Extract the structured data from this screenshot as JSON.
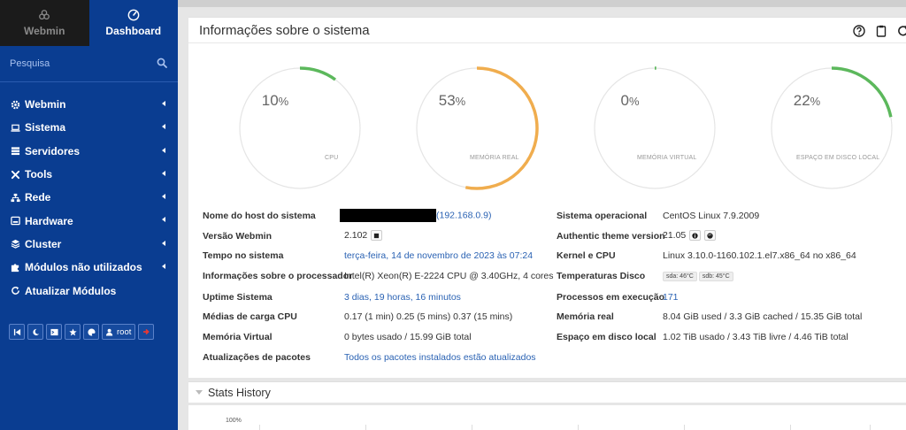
{
  "sidebar": {
    "tabs": [
      {
        "label": "Webmin",
        "icon": "webmin-logo-icon",
        "active": false
      },
      {
        "label": "Dashboard",
        "icon": "dashboard-icon",
        "active": true
      }
    ],
    "search_placeholder": "Pesquisa",
    "menu": [
      {
        "label": "Webmin",
        "icon": "gear-icon"
      },
      {
        "label": "Sistema",
        "icon": "laptop-icon"
      },
      {
        "label": "Servidores",
        "icon": "server-icon"
      },
      {
        "label": "Tools",
        "icon": "tools-icon"
      },
      {
        "label": "Rede",
        "icon": "network-icon"
      },
      {
        "label": "Hardware",
        "icon": "hdd-icon"
      },
      {
        "label": "Cluster",
        "icon": "layers-icon"
      },
      {
        "label": "Módulos não utilizados",
        "icon": "puzzle-icon"
      },
      {
        "label": "Atualizar Módulos",
        "icon": "refresh-icon"
      }
    ],
    "toolbar": {
      "user": "root"
    }
  },
  "panel": {
    "title": "Informações sobre o sistema"
  },
  "gauges": [
    {
      "value": 10,
      "label": "CPU",
      "color": "#5cb85c"
    },
    {
      "value": 53,
      "label": "MEMÓRIA REAL",
      "color": "#f0ad4e"
    },
    {
      "value": 0,
      "label": "MEMÓRIA VIRTUAL",
      "color": "#5cb85c"
    },
    {
      "value": 22,
      "label": "ESPAÇO EM DISCO LOCAL",
      "color": "#5cb85c"
    }
  ],
  "percent_sign": "%",
  "info_left": [
    {
      "label": "Nome do host do sistema",
      "value": "(192.168.0.9)"
    },
    {
      "label": "Versão Webmin",
      "value": "2.102"
    },
    {
      "label": "Tempo no sistema",
      "value": "terça-feira, 14 de novembro de 2023 às 07:24"
    },
    {
      "label": "Informações sobre o processador",
      "value": "Intel(R) Xeon(R) E-2224 CPU @ 3.40GHz, 4 cores"
    },
    {
      "label": "Uptime Sistema",
      "value": "3 dias, 19 horas, 16 minutos"
    },
    {
      "label": "Médias de carga CPU",
      "value": "0.17 (1 min) 0.25 (5 mins) 0.37 (15 mins)"
    },
    {
      "label": "Memória Virtual",
      "value": "0 bytes usado / 15.99 GiB total"
    },
    {
      "label": "Atualizações de pacotes",
      "value": "Todos os pacotes instalados estão atualizados"
    }
  ],
  "info_right": [
    {
      "label": "Sistema operacional",
      "value": "CentOS Linux 7.9.2009"
    },
    {
      "label": "Authentic theme version",
      "value": "21.05"
    },
    {
      "label": "Kernel e CPU",
      "value": "Linux 3.10.0-1160.102.1.el7.x86_64 no x86_64"
    },
    {
      "label": "Temperaturas Disco",
      "chips": [
        "sda: 46°C",
        "sdb: 45°C"
      ]
    },
    {
      "label": "Processos em execução",
      "value": "171"
    },
    {
      "label": "Memória real",
      "value": "8.04 GiB used / 3.3 GiB cached / 15.35 GiB total"
    },
    {
      "label": "Espaço em disco local",
      "value": "1.02 TiB usado / 3.43 TiB livre / 4.46 TiB total"
    }
  ],
  "stats": {
    "title": "Stats History",
    "y_tick": "100%"
  }
}
